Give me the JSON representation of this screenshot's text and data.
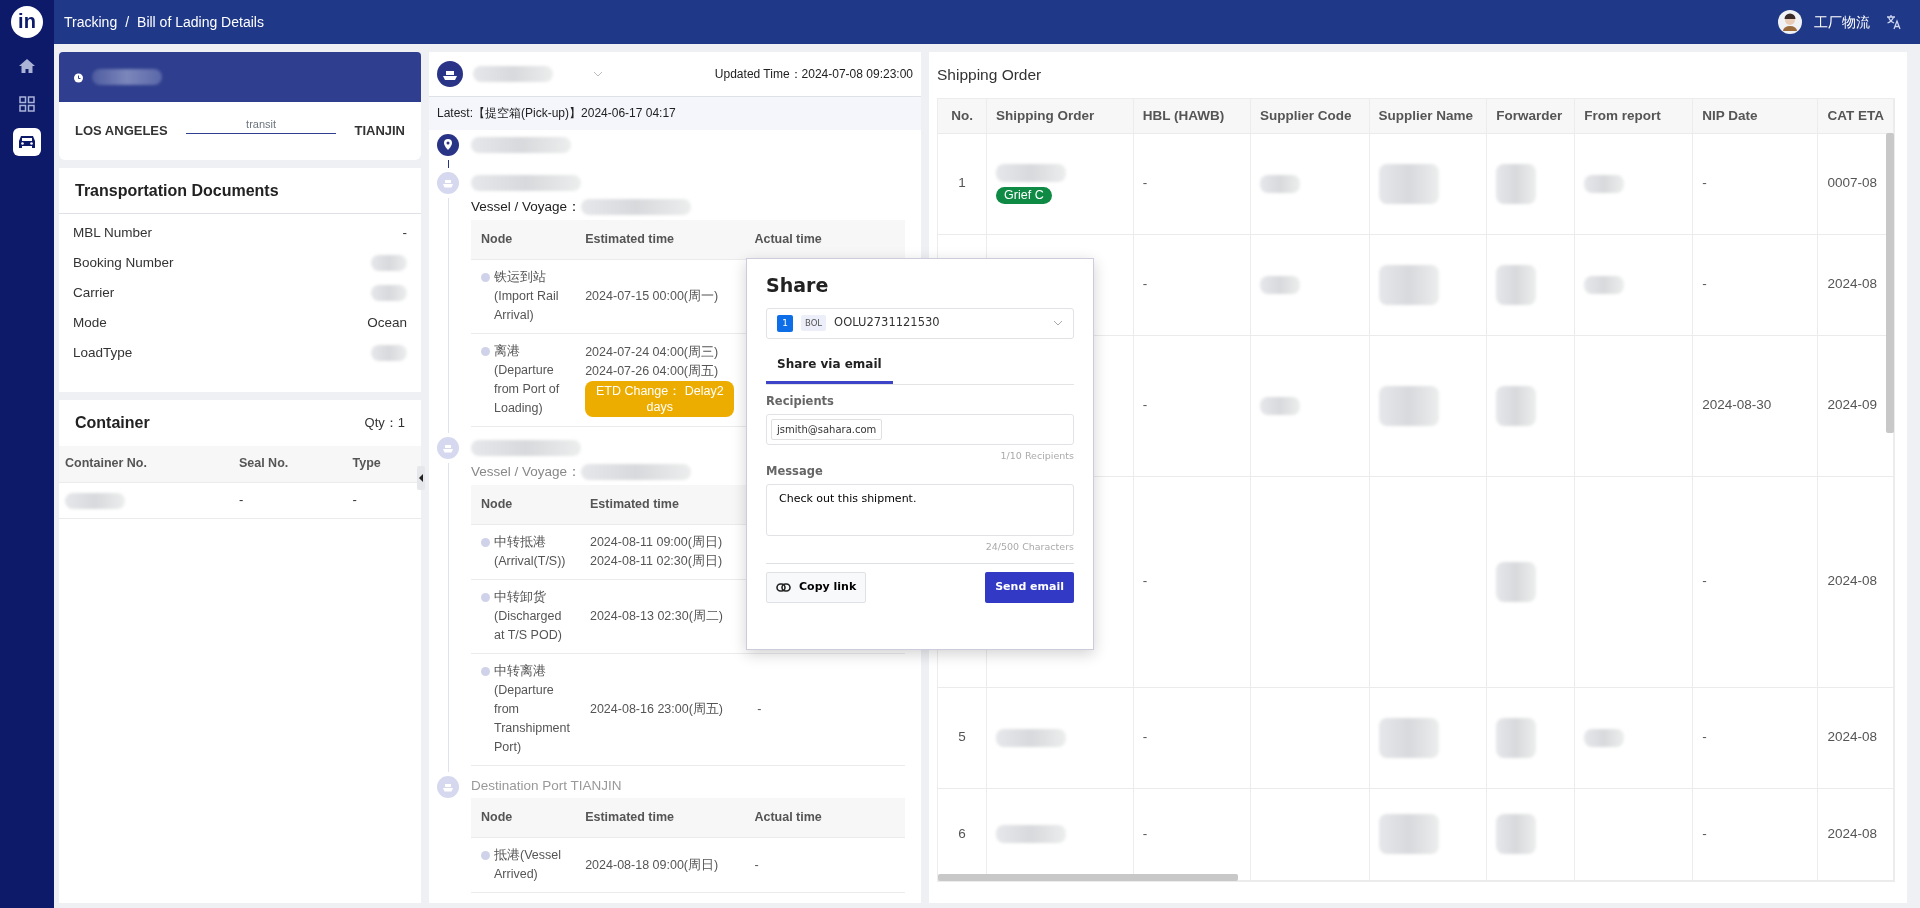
{
  "topbar": {
    "logo": "in",
    "breadcrumb": [
      "Tracking",
      "Bill of Lading Details"
    ],
    "separator": "/",
    "user": "工厂物流"
  },
  "sidebar": {
    "items": [
      {
        "kind": "home",
        "selected": false
      },
      {
        "kind": "apps",
        "selected": false
      },
      {
        "kind": "car",
        "selected": true
      }
    ]
  },
  "route": {
    "origin": "LOS ANGELES",
    "status": "transit",
    "destination": "TIANJIN"
  },
  "documents": {
    "title": "Transportation Documents",
    "fields": [
      {
        "label": "MBL Number",
        "value": {
          "kind": "text",
          "text": "-"
        }
      },
      {
        "label": "Booking Number",
        "value": {
          "kind": "redacted"
        }
      },
      {
        "label": "Carrier",
        "value": {
          "kind": "redacted"
        }
      },
      {
        "label": "Mode",
        "value": {
          "kind": "text",
          "text": "Ocean"
        }
      },
      {
        "label": "LoadType",
        "value": {
          "kind": "redacted"
        }
      }
    ]
  },
  "container": {
    "title": "Container",
    "qty": "Qty：1",
    "columns": [
      "Container No.",
      "Seal No.",
      "Type"
    ],
    "rows": [
      [
        {
          "kind": "redacted"
        },
        {
          "kind": "text",
          "text": "-"
        },
        {
          "kind": "text",
          "text": "-"
        }
      ]
    ]
  },
  "tracking": {
    "updated": "Updated Time：2024-07-08 09:23:00",
    "latest": "Latest:【提空箱(Pick-up)】2024-06-17 04:17",
    "stops": [
      {
        "kind": "origin"
      },
      {
        "kind": "vessel",
        "active": true,
        "vessel_label": "Vessel / Voyage：",
        "columns": [
          "Node",
          "Estimated time",
          "Actual time"
        ],
        "rows": [
          {
            "node": "铁运到站(Import Rail Arrival)",
            "estimated": [
              "2024-07-15 00:00(周一)"
            ]
          },
          {
            "node": "离港(Departure from Port of Loading)",
            "estimated": [
              "2024-07-24 04:00(周三)",
              "2024-07-26 04:00(周五)"
            ],
            "alert": "ETD Change： Delay2 days"
          }
        ]
      },
      {
        "kind": "vessel",
        "active": false,
        "vessel_label": "Vessel / Voyage：",
        "columns": [
          "Node",
          "Estimated time"
        ],
        "rows": [
          {
            "node": "中转抵港(Arrival(T/S))",
            "estimated": [
              "2024-08-11 09:00(周日)",
              "2024-08-11 02:30(周日)"
            ]
          },
          {
            "node": "中转卸货(Discharged at T/S POD)",
            "estimated": [
              "2024-08-13 02:30(周二)"
            ]
          },
          {
            "node": "中转离港(Departure from Transhipment Port)",
            "estimated": [
              "2024-08-16 23:00(周五)"
            ],
            "actual": "-"
          }
        ]
      },
      {
        "kind": "destination",
        "active": false,
        "title": "Destination Port TIANJIN",
        "columns": [
          "Node",
          "Estimated time",
          "Actual time"
        ],
        "rows": [
          {
            "node": "抵港(Vessel Arrived)",
            "estimated": [
              "2024-08-18 09:00(周日)"
            ],
            "actual": "-"
          }
        ]
      }
    ]
  },
  "shipping_orders": {
    "title": "Shipping Order",
    "columns": [
      "No.",
      "Shipping Order",
      "HBL (HAWB)",
      "Supplier Code",
      "Supplier Name",
      "Forwarder",
      "From report",
      "NIP Date",
      "CAT ETA"
    ],
    "rows": [
      {
        "cells": [
          {
            "kind": "text",
            "text": "1"
          },
          {
            "kind": "redacted",
            "tag": "Grief C"
          },
          {
            "kind": "text",
            "text": "-"
          },
          {
            "kind": "redacted"
          },
          {
            "kind": "redacted"
          },
          {
            "kind": "redacted"
          },
          {
            "kind": "redacted"
          },
          {
            "kind": "text",
            "text": "-"
          },
          {
            "kind": "text",
            "text": "0007-08"
          }
        ]
      },
      {
        "cells": [
          {
            "kind": "blank"
          },
          {
            "kind": "blank"
          },
          {
            "kind": "text",
            "text": "-"
          },
          {
            "kind": "redacted"
          },
          {
            "kind": "redacted"
          },
          {
            "kind": "redacted"
          },
          {
            "kind": "redacted"
          },
          {
            "kind": "text",
            "text": "-"
          },
          {
            "kind": "text",
            "text": "2024-08"
          }
        ]
      },
      {
        "cells": [
          {
            "kind": "blank"
          },
          {
            "kind": "blank"
          },
          {
            "kind": "text",
            "text": "-"
          },
          {
            "kind": "redacted"
          },
          {
            "kind": "redacted"
          },
          {
            "kind": "redacted"
          },
          {
            "kind": "blank"
          },
          {
            "kind": "text",
            "text": "2024-08-30"
          },
          {
            "kind": "text",
            "text": "2024-09"
          }
        ]
      },
      {
        "cells": [
          {
            "kind": "blank"
          },
          {
            "kind": "blank"
          },
          {
            "kind": "text",
            "text": "-"
          },
          {
            "kind": "blank"
          },
          {
            "kind": "blank"
          },
          {
            "kind": "redacted"
          },
          {
            "kind": "blank"
          },
          {
            "kind": "text",
            "text": "-"
          },
          {
            "kind": "text",
            "text": "2024-08"
          }
        ]
      },
      {
        "cells": [
          {
            "kind": "text",
            "text": "5"
          },
          {
            "kind": "redacted"
          },
          {
            "kind": "text",
            "text": "-"
          },
          {
            "kind": "blank"
          },
          {
            "kind": "redacted"
          },
          {
            "kind": "redacted"
          },
          {
            "kind": "redacted"
          },
          {
            "kind": "text",
            "text": "-"
          },
          {
            "kind": "text",
            "text": "2024-08"
          }
        ]
      },
      {
        "cells": [
          {
            "kind": "text",
            "text": "6"
          },
          {
            "kind": "redacted"
          },
          {
            "kind": "text",
            "text": "-"
          },
          {
            "kind": "blank"
          },
          {
            "kind": "redacted"
          },
          {
            "kind": "redacted"
          },
          {
            "kind": "blank"
          },
          {
            "kind": "text",
            "text": "-"
          },
          {
            "kind": "text",
            "text": "2024-08"
          }
        ]
      }
    ]
  },
  "share_dialog": {
    "title": "Share",
    "selection": {
      "count": "1",
      "type": "BOL",
      "value": "OOLU2731121530"
    },
    "tabs": [
      {
        "label": "Share via email",
        "selected": true
      }
    ],
    "recipients_label": "Recipients",
    "recipients": [
      "jsmith@sahara.com"
    ],
    "recipients_count": "1/10 Recipients",
    "message_label": "Message",
    "message": "Check out this shipment.",
    "message_count": "24/500 Characters",
    "copy_button": "Copy link",
    "send_button": "Send email"
  }
}
